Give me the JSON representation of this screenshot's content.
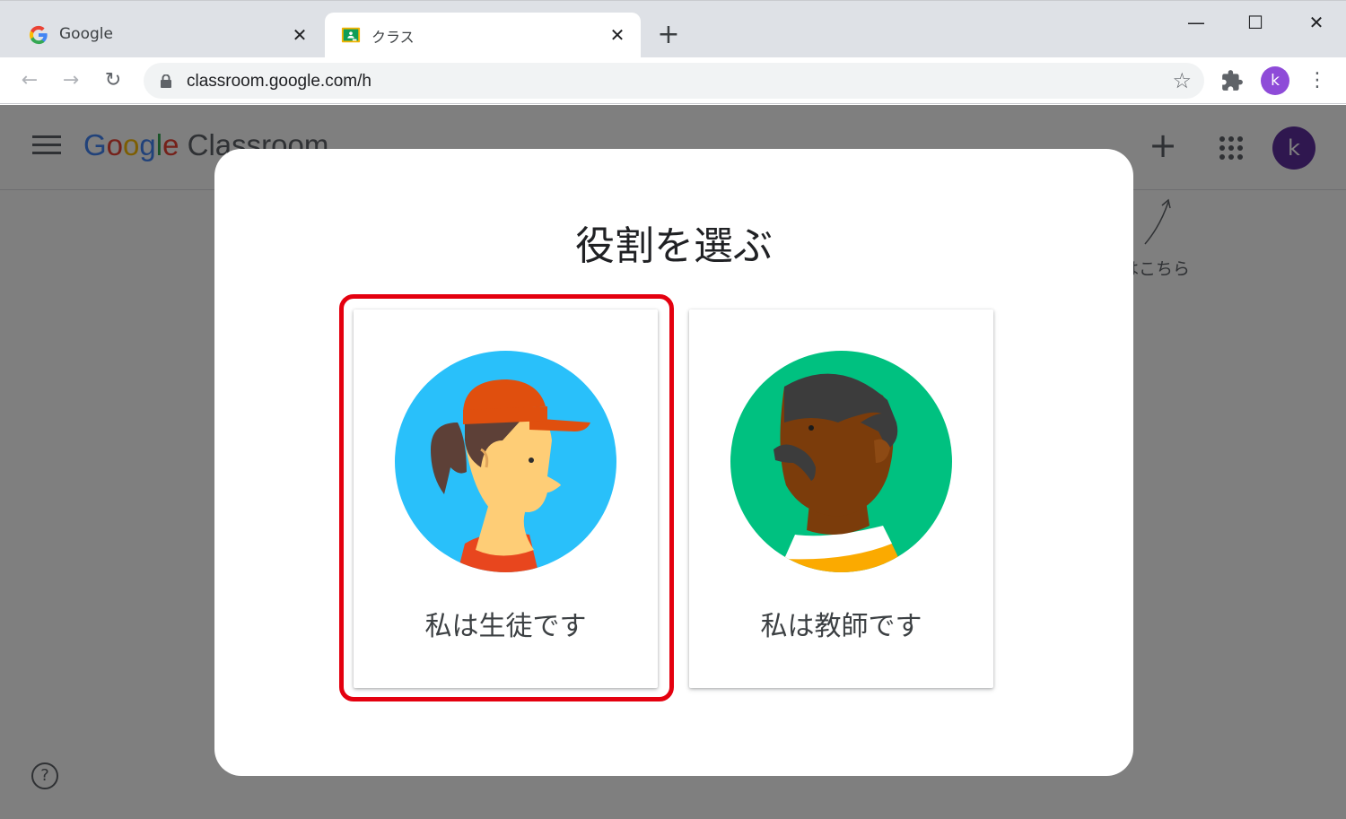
{
  "browser": {
    "tabs": [
      {
        "title": "Google",
        "active": false,
        "icon": "google-g-icon"
      },
      {
        "title": "クラス",
        "active": true,
        "icon": "classroom-icon"
      }
    ],
    "new_tab_label": "+",
    "url": "classroom.google.com/h",
    "profile_initial": "k"
  },
  "app": {
    "logo_text": "Google Classroom",
    "avatar_initial": "k",
    "hint_text": "はこちら",
    "help_label": "?"
  },
  "dialog": {
    "title": "役割を選ぶ",
    "roles": [
      {
        "label": "私は生徒です",
        "icon": "student-illustration",
        "selected": true
      },
      {
        "label": "私は教師です",
        "icon": "teacher-illustration",
        "selected": false
      }
    ]
  },
  "colors": {
    "highlight": "#e4000f",
    "student_bg": "#29c0fa",
    "teacher_bg": "#00c180",
    "avatar": "#5f2f9e"
  }
}
